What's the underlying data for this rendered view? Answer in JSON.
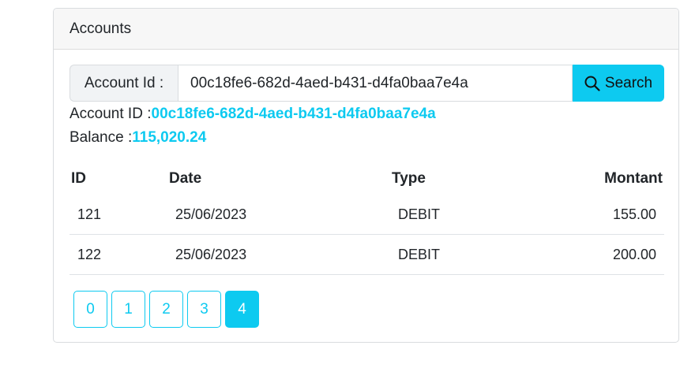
{
  "card": {
    "title": "Accounts"
  },
  "search": {
    "label": "Account Id :",
    "value": "00c18fe6-682d-4aed-b431-d4fa0baa7e4a",
    "button_label": "Search",
    "button_icon": "search-icon"
  },
  "account": {
    "id_label": "Account ID :",
    "id_value": "00c18fe6-682d-4aed-b431-d4fa0baa7e4a",
    "balance_label": "Balance :",
    "balance_value": "115,020.24"
  },
  "table": {
    "headers": [
      "ID",
      "Date",
      "Type",
      "Montant"
    ],
    "rows": [
      [
        "121",
        "25/06/2023",
        "DEBIT",
        "155.00"
      ],
      [
        "122",
        "25/06/2023",
        "DEBIT",
        "200.00"
      ]
    ]
  },
  "pagination": {
    "pages": [
      "0",
      "1",
      "2",
      "3",
      "4"
    ],
    "active": "4"
  },
  "colors": {
    "accent": "#0dcaf0",
    "header_bg": "#f7f7f7",
    "border": "#d9dcdf"
  }
}
